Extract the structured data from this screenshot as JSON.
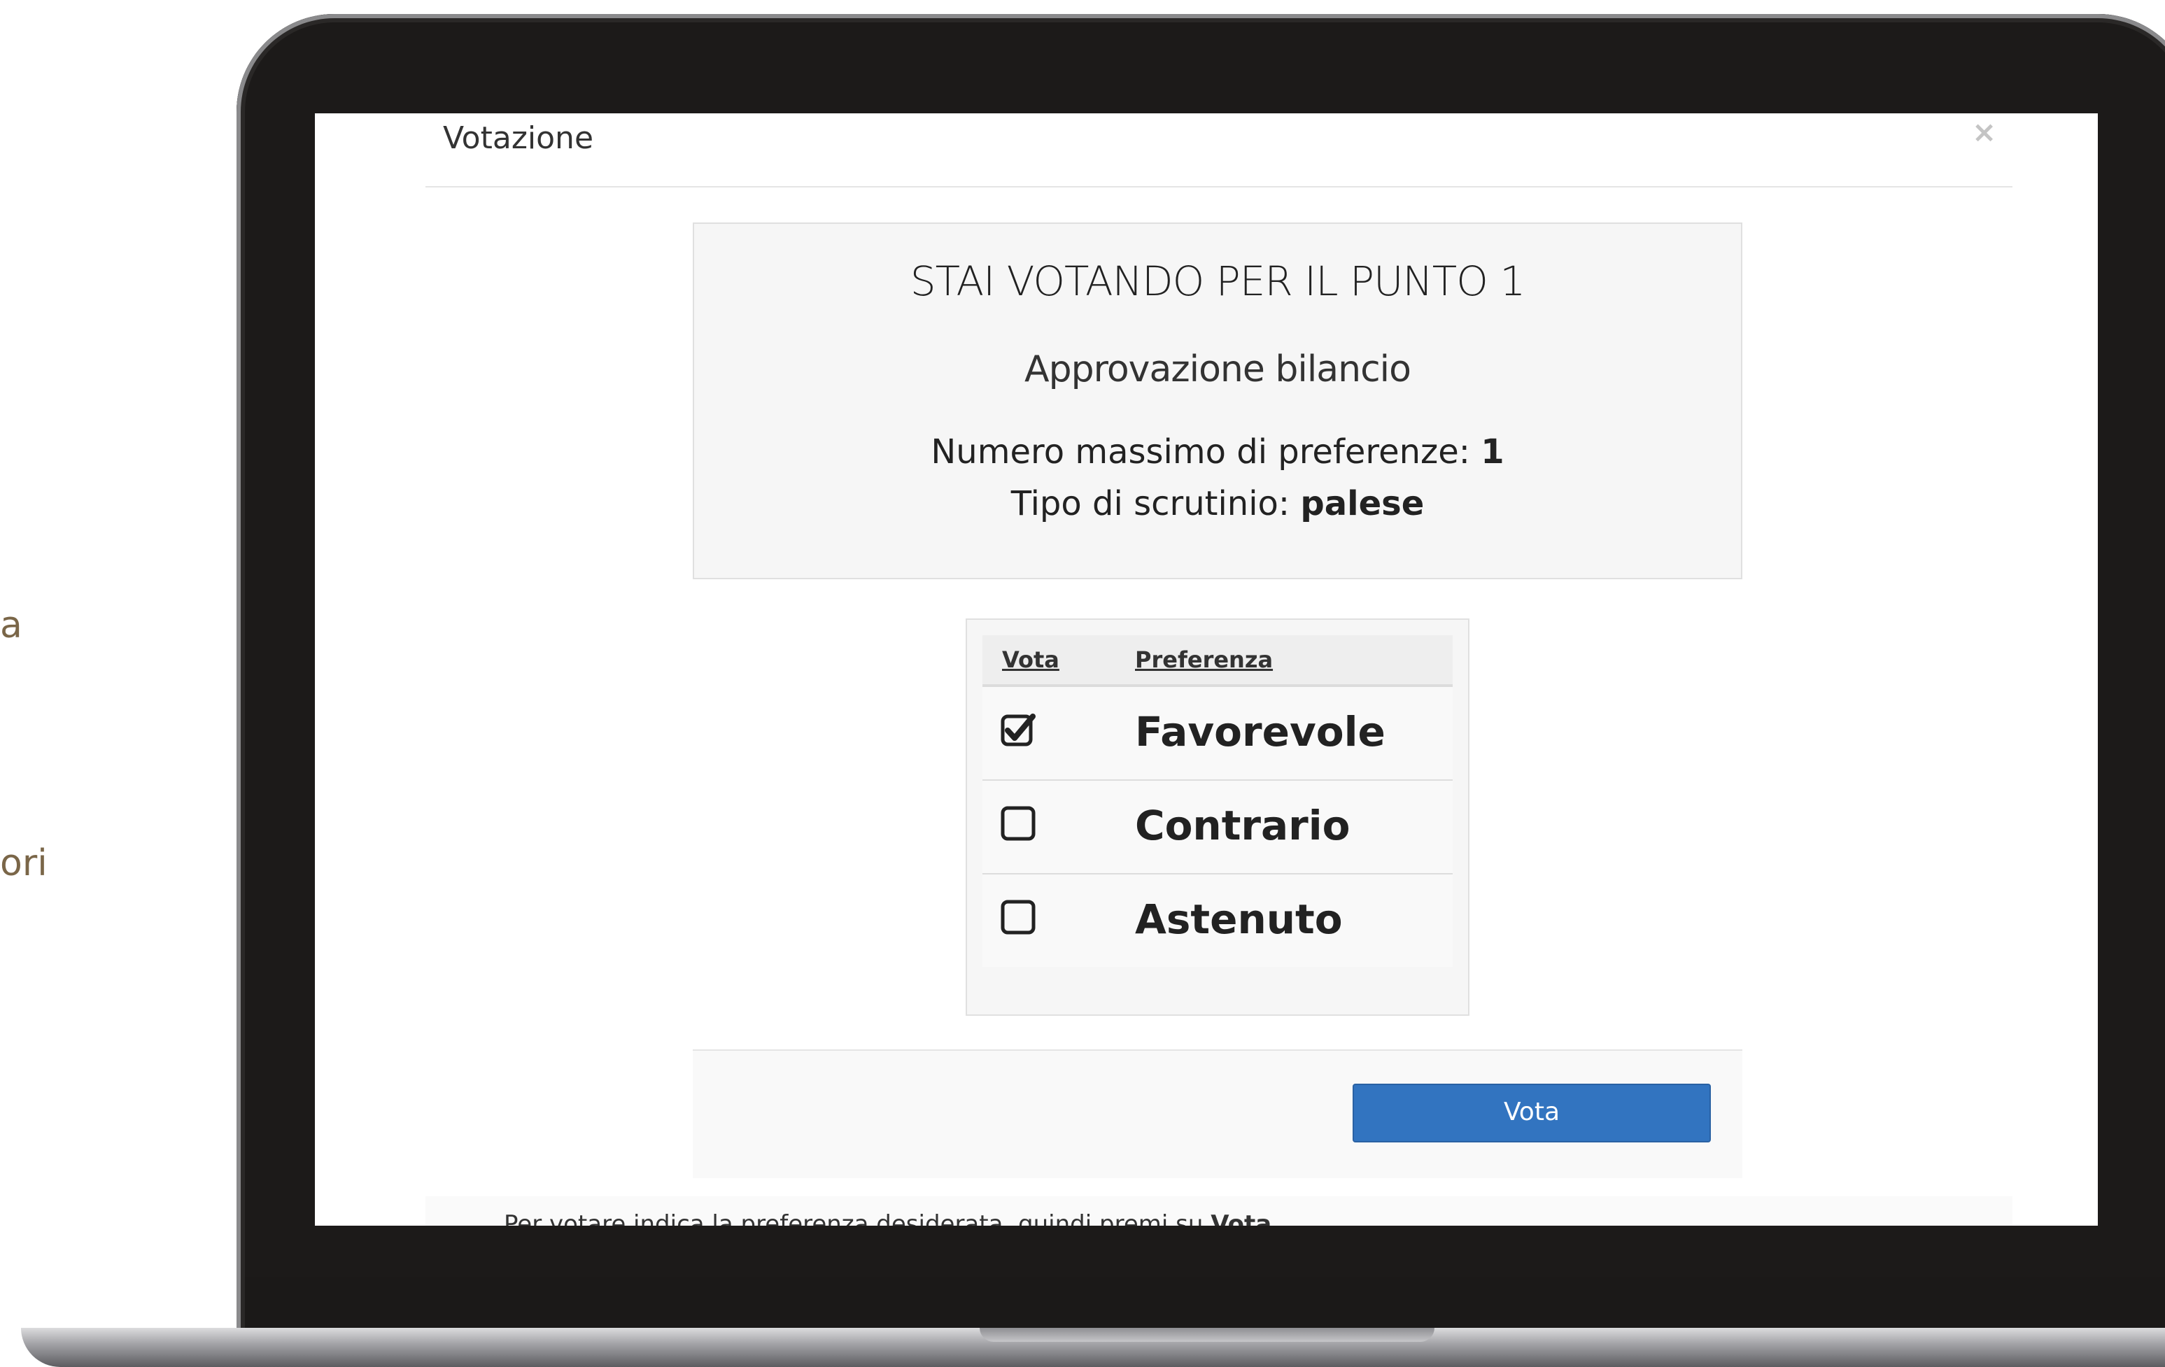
{
  "side_fragments": [
    "a",
    "ori"
  ],
  "modal": {
    "title": "Votazione",
    "close_symbol": "×"
  },
  "info": {
    "heading": "STAI VOTANDO PER IL PUNTO 1",
    "subject": "Approvazione bilancio",
    "max_pref_label": "Numero massimo di preferenze: ",
    "max_pref_value": "1",
    "ballot_type_label": "Tipo di scrutinio: ",
    "ballot_type_value": "palese"
  },
  "table": {
    "col_vote": "Vota",
    "col_preference": "Preferenza",
    "options": [
      {
        "label": "Favorevole",
        "checked": true
      },
      {
        "label": "Contrario",
        "checked": false
      },
      {
        "label": "Astenuto",
        "checked": false
      }
    ]
  },
  "footer": {
    "vote_button": "Vota",
    "instruction_prefix": "Per votare indica la preferenza desiderata, quindi premi su ",
    "instruction_bold": "Vota"
  },
  "icons": {
    "checked": "checkbox-checked-icon",
    "unchecked": "checkbox-empty-icon"
  },
  "colors": {
    "primary_button": "#3274c0",
    "panel_bg": "#f6f6f6",
    "side_text": "#7a6648"
  }
}
